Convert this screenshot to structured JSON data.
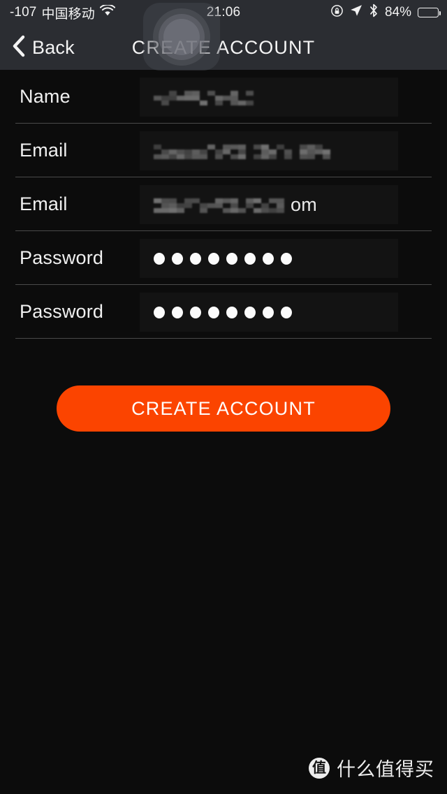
{
  "status_bar": {
    "signal_strength": "-107",
    "carrier": "中国移动",
    "wifi_icon": "wifi-icon",
    "time": "21:06",
    "rotation_lock_icon": "rotation-lock-icon",
    "location_icon": "location-arrow-icon",
    "bluetooth_icon": "bluetooth-icon",
    "battery_percent": "84%",
    "battery_level": 84,
    "battery_icon": "battery-icon",
    "background_color": "#2b2d32"
  },
  "nav_bar": {
    "back_icon": "chevron-left-icon",
    "back_label": "Back",
    "title": "CREATE ACCOUNT",
    "background_color": "#2b2d32"
  },
  "assistive_touch": {
    "name": "assistive-touch-button"
  },
  "form": {
    "fields": [
      {
        "label": "Name",
        "value_type": "redacted",
        "value": "",
        "redact_width": 148
      },
      {
        "label": "Email",
        "value_type": "redacted",
        "value": "",
        "redact_width": 248
      },
      {
        "label": "Email",
        "value_type": "redacted_with_tail",
        "value": "",
        "tail": "om",
        "redact_width": 192
      },
      {
        "label": "Password",
        "value_type": "password",
        "value": "",
        "dot_count": 8
      },
      {
        "label": "Password",
        "value_type": "password",
        "value": "",
        "dot_count": 8
      }
    ],
    "divider_color": "#4a4a4a",
    "input_background": "#131313"
  },
  "primary_action": {
    "label": "CREATE ACCOUNT",
    "background_color": "#fb4400",
    "text_color": "#ffffff"
  },
  "watermark": {
    "badge": "值",
    "text": "什么值得买"
  },
  "page": {
    "background_color": "#0c0c0c"
  }
}
